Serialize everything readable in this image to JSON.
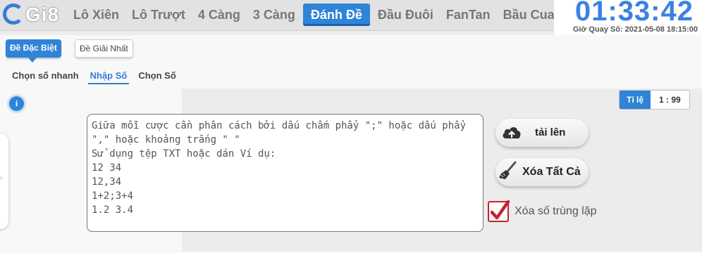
{
  "brand": {
    "logo_text": "Gi8"
  },
  "nav": {
    "tabs": [
      {
        "label": "Lô Xiên"
      },
      {
        "label": "Lô Trượt"
      },
      {
        "label": "4 Càng"
      },
      {
        "label": "3 Càng"
      },
      {
        "label": "Đánh Đề",
        "active": true
      },
      {
        "label": "Đầu Đuôi"
      },
      {
        "label": "FanTan"
      },
      {
        "label": "Bầu Cua"
      }
    ]
  },
  "clock": {
    "countdown": "01:33:42",
    "draw_time": "Giờ Quay Số: 2021-05-08 18:15:00"
  },
  "bet_types": {
    "special": "Đề Đặc Biệt",
    "first_prize": "Đề Giải Nhất"
  },
  "input_modes": {
    "quick": "Chọn số nhanh",
    "enter": "Nhập Số",
    "choose": "Chọn Số"
  },
  "info_button": "i",
  "ratio": {
    "label": "Tỉ lệ",
    "value": "1 : 99"
  },
  "numbers_input": {
    "placeholder": "Giữa mỗi cược cần phân cách bởi dấu chấm phẩy \";\" hoặc dấu phẩy\n\",\" hoặc khoảng trắng \" \"\nSử dụng tệp TXT hoặc dán Ví dụ:\n12 34\n12,34\n1+2;3+4\n1.2 3.4",
    "value": ""
  },
  "actions": {
    "upload": "tải lên",
    "clear_all": "Xóa Tất Cả"
  },
  "dedupe": {
    "label": "Xóa số trùng lặp",
    "checked": true
  },
  "colors": {
    "accent": "#2f84d8",
    "clock": "#3b82e0",
    "checkbox": "#c4222f"
  },
  "icons": [
    "upload-cloud-icon",
    "broom-icon",
    "check-icon",
    "info-icon"
  ]
}
